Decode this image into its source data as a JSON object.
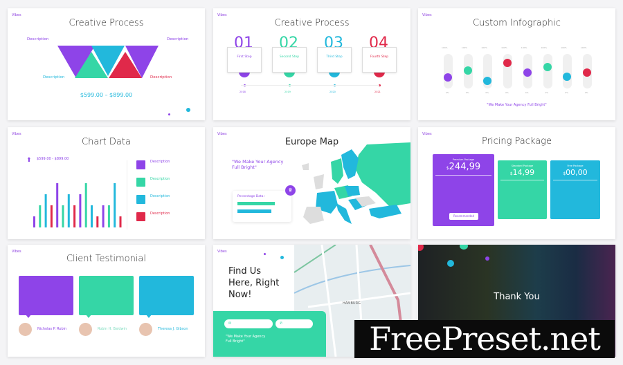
{
  "brand": "Vibes",
  "colors": {
    "purple": "#8e44e8",
    "green": "#35d6a6",
    "blue": "#22b8dc",
    "red": "#e0294a"
  },
  "slides": {
    "creative_process_1": {
      "title": "Creative Process",
      "descriptions": [
        "Description",
        "Description",
        "Description",
        "Description"
      ],
      "price_range": "$599.00 – $899.00"
    },
    "creative_process_2": {
      "title": "Creative Process",
      "steps": [
        {
          "number": "01",
          "label": "First Step",
          "year": "2018"
        },
        {
          "number": "02",
          "label": "Second Step",
          "year": "2019"
        },
        {
          "number": "03",
          "label": "Third Step",
          "year": "2020"
        },
        {
          "number": "04",
          "label": "Fourth Step",
          "year": "2021"
        }
      ]
    },
    "custom_infographic": {
      "title": "Custom Infographic",
      "top_label": "100%",
      "bottom_label": "0%",
      "levels": [
        0.32,
        0.52,
        0.22,
        0.75,
        0.47,
        0.63,
        0.34,
        0.47
      ],
      "quote": "\"We Make Your Agency Full Bright\""
    },
    "chart_data": {
      "title": "Chart Data",
      "price_range": "$599.00 - $899.00",
      "descriptions": [
        "Description",
        "Description",
        "Description",
        "Description"
      ]
    },
    "europe_map": {
      "title": "Europe Map",
      "quote": "\"We Make Your Agency Full Bright\"",
      "percentage_title": "Percentage Data :",
      "bars": [
        0.8,
        0.72
      ]
    },
    "pricing": {
      "title": "Pricing Package",
      "packages": [
        {
          "name": "Premium Package",
          "currency": "$",
          "price": "244,99",
          "button": "Recommended"
        },
        {
          "name": "Standard Package",
          "currency": "$",
          "price": "14,99"
        },
        {
          "name": "Free Package",
          "currency": "$",
          "price": "00,00"
        }
      ]
    },
    "testimonial": {
      "title": "Client Testimonial",
      "clients": [
        {
          "name": "Nicholas P. Robin"
        },
        {
          "name": "Robin H. Baldwin"
        },
        {
          "name": "Theresa J. Gibson"
        }
      ]
    },
    "find_us": {
      "heading_lines": [
        "Find Us",
        "Here, Right",
        "Now!"
      ],
      "map_label": "HAMBURG",
      "quote": "\"We Make Your Agency Full Bright\""
    },
    "thank_you": {
      "title": "Thank You"
    }
  },
  "chart_data": {
    "type": "bar",
    "values": [
      1,
      2,
      3,
      2,
      4,
      2,
      3,
      2,
      3,
      4,
      2,
      1,
      2,
      2,
      4,
      1
    ],
    "colors": [
      "purple",
      "green",
      "blue",
      "red",
      "purple",
      "green",
      "blue",
      "red",
      "purple",
      "green",
      "blue",
      "red",
      "purple",
      "green",
      "blue",
      "red"
    ]
  },
  "watermark": "FreePreset.net"
}
